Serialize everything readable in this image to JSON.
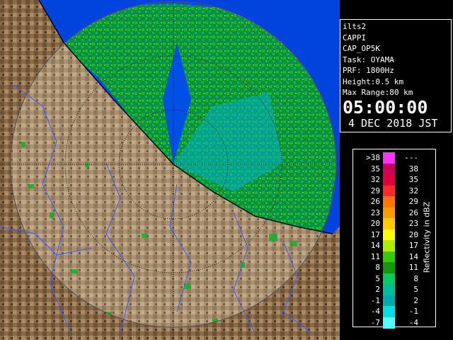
{
  "info": {
    "lines": [
      "ilts2",
      "CAPPI",
      "CAP_OP5K",
      "Task: OYAMA",
      "PRF: 1800Hz",
      "Height:0.5 km",
      "Max Range:80 km"
    ],
    "time": "05:00:00",
    "date": "4 DEC 2018 JST"
  },
  "legend": {
    "unit": "Reflectivity in dBZ",
    "rows": [
      {
        "min": ">38",
        "max": "---",
        "color": "#ff33ff"
      },
      {
        "min": "35",
        "max": "38",
        "color": "#cc0055"
      },
      {
        "min": "32",
        "max": "35",
        "color": "#e0003a"
      },
      {
        "min": "29",
        "max": "32",
        "color": "#ff2a2a"
      },
      {
        "min": "26",
        "max": "29",
        "color": "#ff7700"
      },
      {
        "min": "23",
        "max": "26",
        "color": "#ff9a00"
      },
      {
        "min": "20",
        "max": "23",
        "color": "#ffcc00"
      },
      {
        "min": "17",
        "max": "20",
        "color": "#ffff00"
      },
      {
        "min": "14",
        "max": "17",
        "color": "#aaee00"
      },
      {
        "min": "11",
        "max": "14",
        "color": "#33cc00"
      },
      {
        "min": "8",
        "max": "11",
        "color": "#119900"
      },
      {
        "min": "5",
        "max": "8",
        "color": "#00cc66"
      },
      {
        "min": "2",
        "max": "5",
        "color": "#00bb99"
      },
      {
        "min": "-1",
        "max": "2",
        "color": "#00aaaa"
      },
      {
        "min": "-4",
        "max": "-1",
        "color": "#00dddd"
      },
      {
        "min": "-7",
        "max": "-4",
        "color": "#55ffff"
      }
    ]
  },
  "map": {
    "sea_color": "#0044dd",
    "range_color": "#6a6a70",
    "grid_color": "#000000",
    "radar_center": "0044dd"
  }
}
